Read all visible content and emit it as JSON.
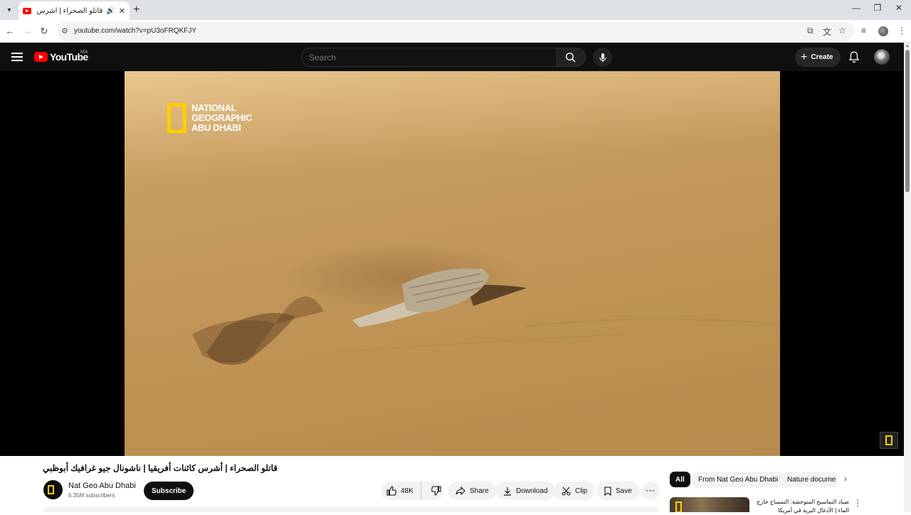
{
  "browser": {
    "tab_title": "قاتلو الصحراء | أشرس كائنات",
    "url": "youtube.com/watch?v=pU3oFRQKFJY"
  },
  "youtube": {
    "logo_text": "YouTube",
    "region": "MA",
    "search_placeholder": "Search",
    "create_label": "Create"
  },
  "video": {
    "brand_lines": [
      "NATIONAL",
      "GEOGRAPHIC",
      "ABU DHABI"
    ],
    "title": "قاتلو الصحراء | أشرس كائنات أفريقيا | ناشونال جيو غرافيك أبوظبي",
    "channel_name": "Nat Geo Abu Dhabi",
    "subscribers": "6.35M subscribers",
    "subscribe_label": "Subscribe",
    "likes": "48K",
    "share_label": "Share",
    "download_label": "Download",
    "clip_label": "Clip",
    "save_label": "Save"
  },
  "sidebar": {
    "chips": [
      "All",
      "From Nat Geo Abu Dhabi",
      "Nature docume"
    ],
    "recommended": {
      "title": "صياد التماسيح المتوحشة: التمساح خارج الماء | الأدغال البرية في أمريكا"
    }
  },
  "colors": {
    "brand_red": "#ff0000",
    "natgeo_yellow": "#ffce00",
    "header_bg": "#0f0f0f"
  }
}
